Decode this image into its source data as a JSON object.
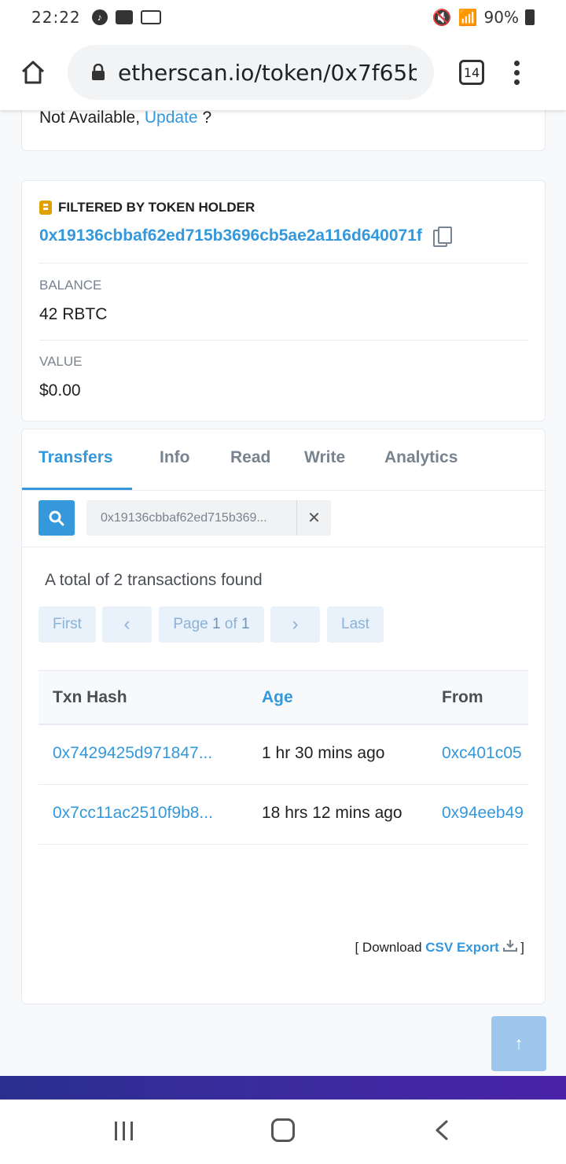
{
  "status_bar": {
    "time": "22:22",
    "battery": "90%"
  },
  "browser": {
    "url": "etherscan.io/token/0x7f65be",
    "tab_count": "14"
  },
  "top_card": {
    "not_available": "Not Available,",
    "update_link": "Update",
    "question": "?"
  },
  "holder": {
    "title": "FILTERED BY TOKEN HOLDER",
    "address": "0x19136cbbaf62ed715b3696cb5ae2a116d640071f",
    "balance_label": "BALANCE",
    "balance_value": "42 RBTC",
    "value_label": "VALUE",
    "value_value": "$0.00"
  },
  "tabs": [
    {
      "label": "Transfers",
      "active": true
    },
    {
      "label": "Info"
    },
    {
      "label": "Read"
    },
    {
      "label": "Write"
    },
    {
      "label": "Analytics"
    }
  ],
  "filter": {
    "value": "0x19136cbbaf62ed715b369...",
    "close": "✕"
  },
  "summary": "A total of 2 transactions found",
  "pager": {
    "first": "First",
    "prev": "‹",
    "page_prefix": "Page",
    "page_current": "1",
    "page_of": "of",
    "page_total": "1",
    "next": "›",
    "last": "Last"
  },
  "table": {
    "headers": {
      "hash": "Txn Hash",
      "age": "Age",
      "from": "From"
    },
    "rows": [
      {
        "hash": "0x7429425d971847...",
        "age": "1 hr 30 mins ago",
        "from": "0xc401c05"
      },
      {
        "hash": "0x7cc11ac2510f9b8...",
        "age": "18 hrs 12 mins ago",
        "from": "0x94eeb49"
      }
    ]
  },
  "csv": {
    "prefix": "[ Download",
    "link": "CSV Export",
    "suffix": "]"
  },
  "scroll_top": "↑",
  "colors": {
    "accent": "#3498db",
    "badge": "#e0a100",
    "footer": "#2a2f8f"
  }
}
